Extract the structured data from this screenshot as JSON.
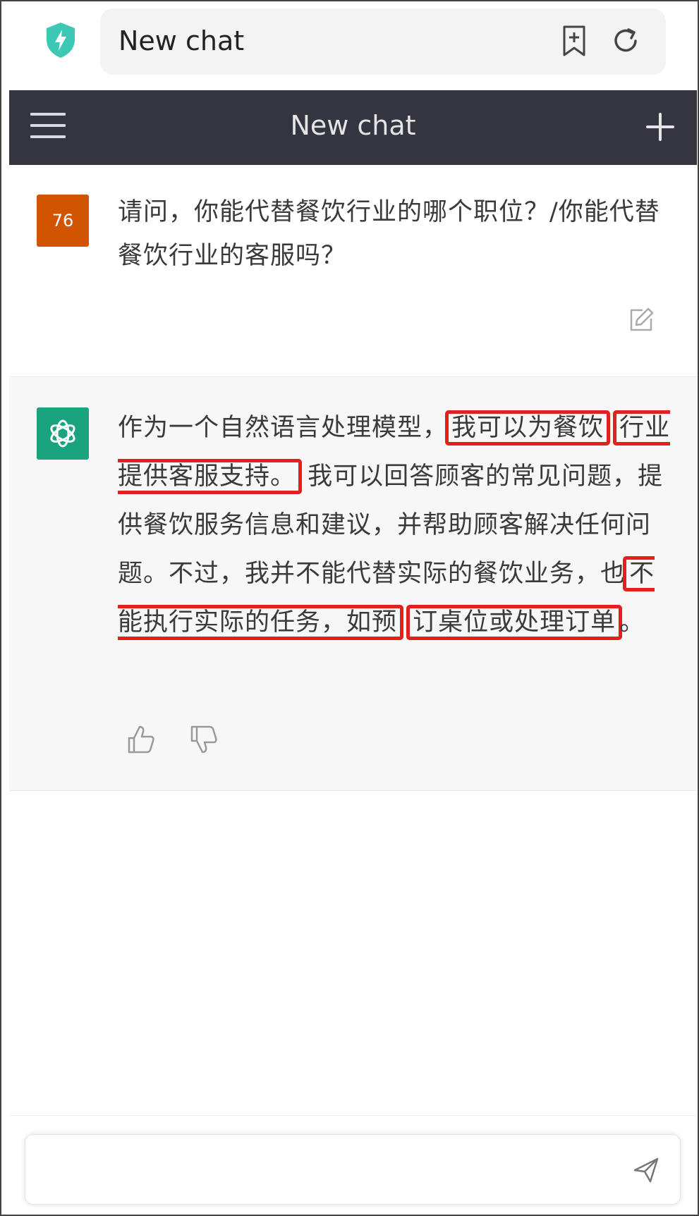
{
  "browser": {
    "title": "New chat",
    "icons": [
      "shield-bolt-icon",
      "bookmark-add-icon",
      "reload-icon"
    ]
  },
  "header": {
    "title": "New chat",
    "icons": [
      "menu-icon",
      "plus-icon"
    ]
  },
  "conversation": {
    "user": {
      "avatar_text": "76",
      "avatar_color": "#d35400",
      "text": "请问，你能代替餐饮行业的哪个职位？/你能代替餐饮行业的客服吗？"
    },
    "assistant": {
      "avatar_color": "#19a37f",
      "segments": [
        "作为一个自然语言处理模型，",
        "我可以为餐饮",
        "行业提供客服支持。",
        "我可以回答顾客的常见问题，提供餐饮服务信息和建议，并帮助顾客解决任何问题。不过，我并不能代替实际的餐饮业务，也",
        "不能执行实际的任务，如预",
        "订桌位或处理订单",
        "。"
      ],
      "highlight_color": "#e32020"
    }
  },
  "composer": {
    "placeholder": "",
    "send_icon": "send-icon"
  }
}
